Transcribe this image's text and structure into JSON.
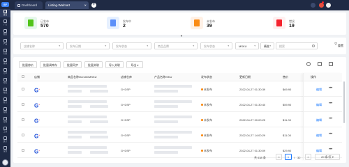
{
  "sidebar": {
    "logo": "SF",
    "items": [
      {
        "label": "首页"
      },
      {
        "label": "广告"
      },
      {
        "label": "数据"
      },
      {
        "label": "产品"
      },
      {
        "label": "刊登"
      },
      {
        "label": "采购"
      },
      {
        "label": "订单"
      },
      {
        "label": "仓库"
      },
      {
        "label": "物流"
      },
      {
        "label": "财务"
      },
      {
        "label": "客服"
      },
      {
        "label": "营销"
      },
      {
        "label": "工具"
      },
      {
        "label": "统计"
      },
      {
        "label": "设置"
      }
    ]
  },
  "topbar": {
    "tabs": [
      {
        "label": "Dashboard"
      },
      {
        "label": "Listing-Walmart"
      }
    ],
    "add_label": "+"
  },
  "summary": [
    {
      "name": "已发布",
      "value": "570",
      "color": "#e6f7ec",
      "icon_color": "#52c41a"
    },
    {
      "name": "发布中",
      "value": "2",
      "color": "#e6f0ff",
      "icon_color": "#5b8ff9"
    },
    {
      "name": "未发布",
      "value": "39",
      "color": "#fff1e6",
      "icon_color": "#fa8c16"
    },
    {
      "name": "错误",
      "value": "19",
      "color": "#fff0f0",
      "icon_color": "#f5222d"
    }
  ],
  "filters": {
    "f1": "店铺名称",
    "f2": "发布日期",
    "f3": "发布状态",
    "f4": "商品品牌",
    "f5": "发布状态",
    "f6": "MSKU",
    "f7": "精准",
    "search_placeholder": "搜索",
    "reset": "重置"
  },
  "toolbar": {
    "b1": "批量修价",
    "b2": "批量调库存",
    "b3": "批量同步",
    "b4": "批量关联",
    "b5": "导入关联",
    "b6": "导出 ▾"
  },
  "table": {
    "headers": {
      "store": "店铺",
      "product": "商品名称/ItemID/MSKU",
      "warehouse": "店铺仓库",
      "product_sku": "产品名称/SKU",
      "status": "发布状态",
      "date": "更新日期",
      "price": "售价",
      "op": "操作"
    },
    "rows": [
      {
        "warehouse": "G+DSP",
        "status": "未发布",
        "date": "2022-04-27 01:30:39",
        "price": "$69.90",
        "op": "编辑"
      },
      {
        "warehouse": "G+DSP",
        "status": "未发布",
        "date": "2022-04-27 01:30:40",
        "price": "$59.90",
        "op": "编辑"
      },
      {
        "warehouse": "G+DSP",
        "status": "未发布",
        "date": "2022-04-27 00:00:25",
        "price": "$11.00",
        "op": "编辑"
      },
      {
        "warehouse": "G+DSP",
        "status": "未发布",
        "date": "2022-04-27 14:00:29",
        "price": "$11.00",
        "op": "编辑"
      },
      {
        "warehouse": "G+DSP",
        "status": "未发布",
        "date": "2022-04-27 01:30:09",
        "price": "$29.90",
        "op": "编辑"
      }
    ]
  },
  "pager": {
    "total": "共 638 条",
    "prev": "<",
    "page": "1",
    "sep": "/",
    "pages": "32",
    "next": ">",
    "size": "20 条/页 ▾"
  }
}
